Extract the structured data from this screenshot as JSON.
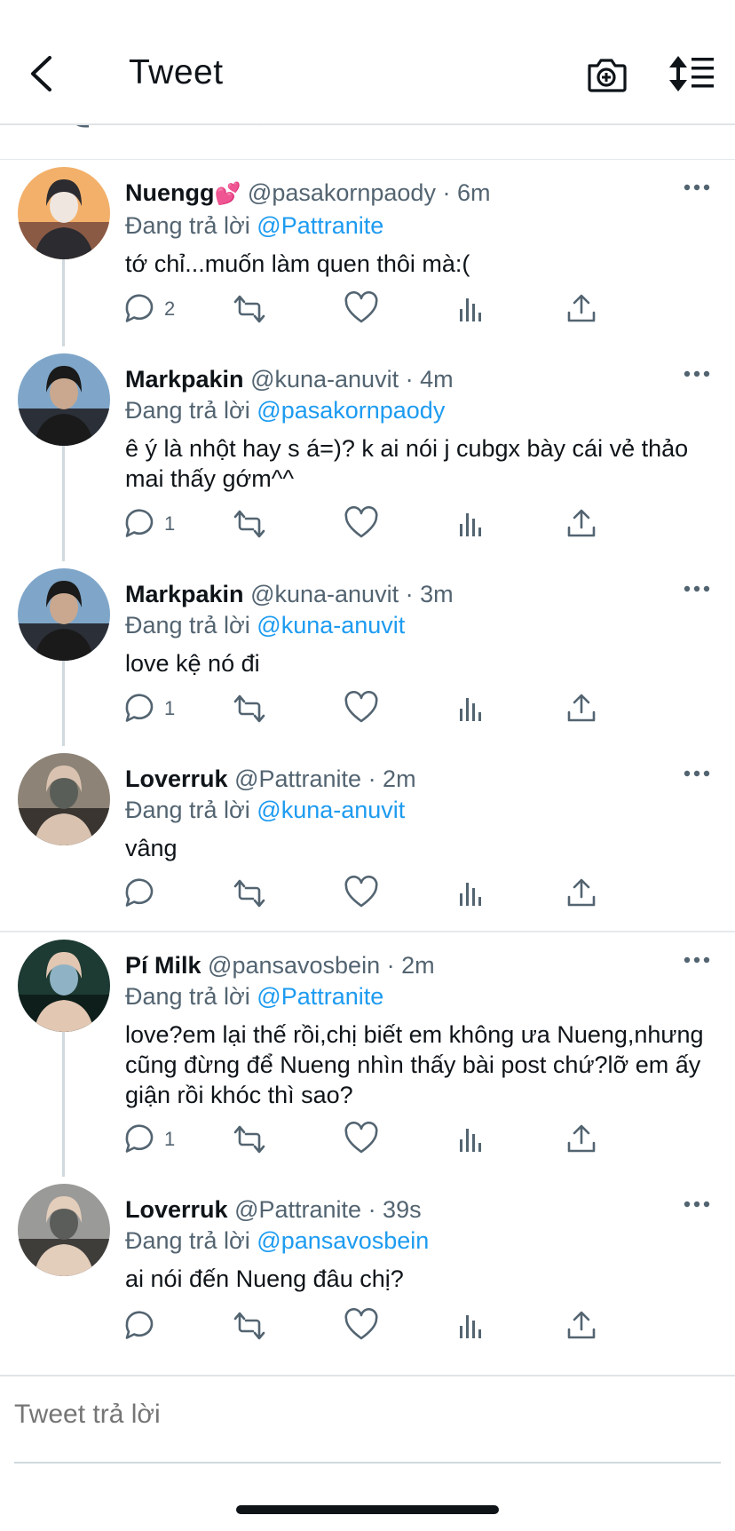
{
  "header": {
    "title": "Tweet"
  },
  "tweets": [
    {
      "name": "Nuengg",
      "emoji": "💕",
      "handle": "@pasakornpaody",
      "time": "· 6m",
      "reply_prefix": "Đang trả lời",
      "reply_to": "@Pattranite",
      "text": "tớ chỉ...muốn làm quen thôi mà:(",
      "replies": "2"
    },
    {
      "name": "Markpakin",
      "handle": "@kuna-anuvit",
      "time": "· 4m",
      "reply_prefix": "Đang trả lời",
      "reply_to": "@pasakornpaody",
      "text": "ê ý là nhột hay s á=)? k ai nói j cubgx bày cái vẻ thảo mai thấy gớm^^",
      "replies": "1"
    },
    {
      "name": "Markpakin",
      "handle": "@kuna-anuvit",
      "time": "· 3m",
      "reply_prefix": "Đang trả lời",
      "reply_to": "@kuna-anuvit",
      "text": "love kệ nó đi",
      "replies": "1"
    },
    {
      "name": "Loverruk",
      "handle": "@Pattranite",
      "time": "· 2m",
      "reply_prefix": "Đang trả lời",
      "reply_to": "@kuna-anuvit",
      "text": "vâng",
      "replies": ""
    },
    {
      "name": "Pí Milk",
      "handle": "@pansavosbein",
      "time": "· 2m",
      "reply_prefix": "Đang trả lời",
      "reply_to": "@Pattranite",
      "text": "love?em lại thế rồi,chị biết em không ưa Nueng,nhưng cũng đừng để Nueng nhìn thấy bài post chứ?lỡ em ấy giận rồi khóc thì sao?",
      "replies": "1"
    },
    {
      "name": "Loverruk",
      "handle": "@Pattranite",
      "time": "· 39s",
      "reply_prefix": "Đang trả lời",
      "reply_to": "@pansavosbein",
      "text": "ai nói đến Nueng đâu chị?",
      "replies": ""
    }
  ],
  "reply_box": {
    "placeholder": "Tweet trả lời"
  },
  "colors": {
    "accent": "#1d9bf0",
    "muted": "#536471",
    "text": "#0f1419",
    "divider": "#e6e9ec"
  },
  "icons": [
    "back-arrow-icon",
    "camera-plus-icon",
    "sort-icon",
    "more-icon",
    "reply-icon",
    "retweet-icon",
    "like-icon",
    "views-icon",
    "share-icon"
  ]
}
